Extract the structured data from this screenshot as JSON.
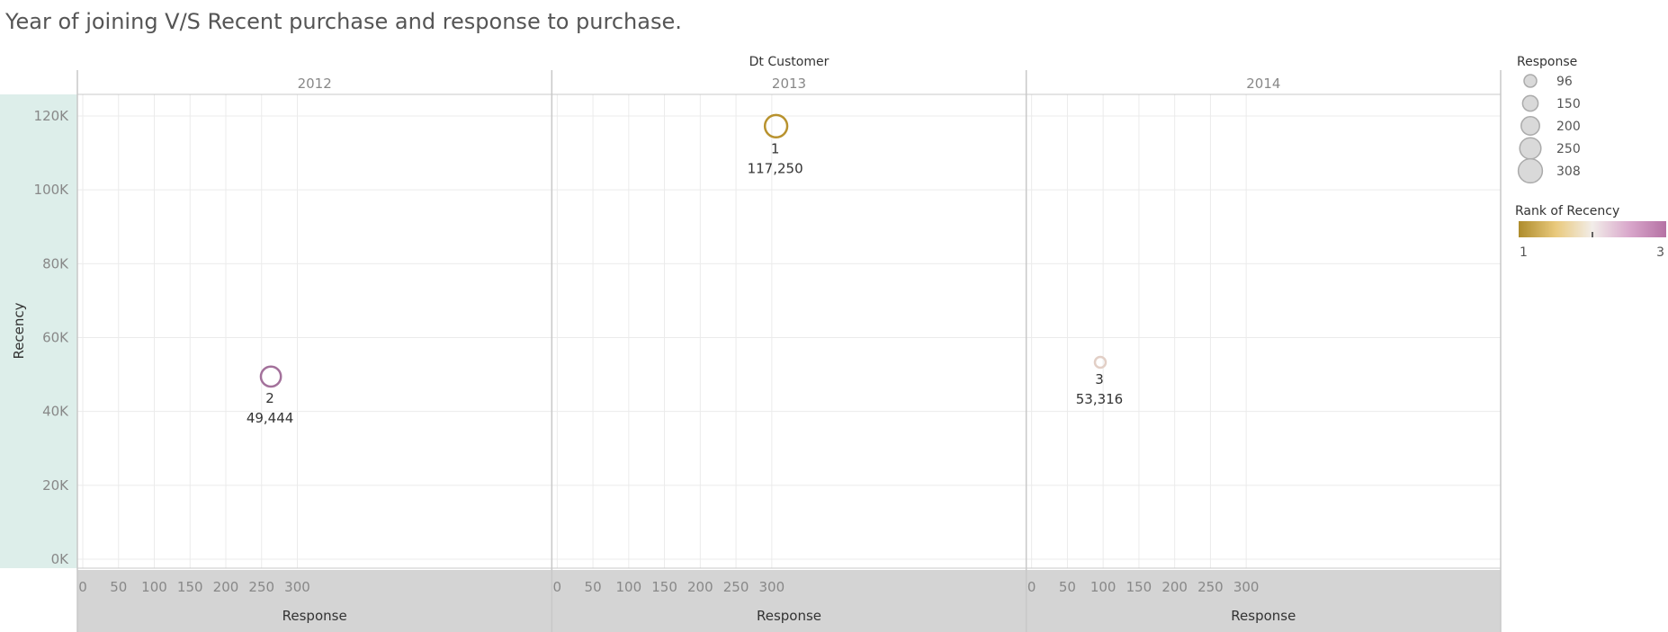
{
  "title": "Year of joining V/S Recent purchase and response to purchase.",
  "chart_data": {
    "type": "scatter",
    "column_header": "Dt Customer",
    "panels": [
      "2012",
      "2013",
      "2014"
    ],
    "xlabel": "Response",
    "ylabel": "Recency",
    "xlim": [
      0,
      330
    ],
    "ylim": [
      0,
      126000
    ],
    "x_ticks": [
      0,
      50,
      100,
      150,
      200,
      250,
      300
    ],
    "y_ticks": [
      0,
      20000,
      40000,
      60000,
      80000,
      100000,
      120000
    ],
    "y_tick_labels": [
      "0K",
      "20K",
      "40K",
      "60K",
      "80K",
      "100K",
      "120K"
    ],
    "grid": true,
    "points": [
      {
        "panel": "2012",
        "x": 263,
        "y": 49444,
        "rank": 2,
        "rank_label": "2",
        "value_label": "49,444",
        "color": "#A3719B"
      },
      {
        "panel": "2013",
        "x": 306,
        "y": 117250,
        "rank": 1,
        "rank_label": "1",
        "value_label": "117,250",
        "color": "#B8922E"
      },
      {
        "panel": "2014",
        "x": 96,
        "y": 53316,
        "rank": 3,
        "rank_label": "3",
        "value_label": "53,316",
        "color": "#E2CFC6"
      }
    ],
    "size_legend": {
      "title": "Response",
      "entries": [
        "96",
        "150",
        "200",
        "250",
        "308"
      ]
    },
    "color_legend": {
      "title": "Rank of Recency",
      "min_label": "1",
      "max_label": "3",
      "colors": [
        "#AE8C2C",
        "#E9C97C",
        "#F2EDE9",
        "#D9A7CB",
        "#B572A4"
      ]
    },
    "colors": {
      "panel_band": "#DDEEEA",
      "axis_band": "#D4D4D4",
      "grid": "#EBEBEB",
      "divider": "#C8C8C8"
    }
  }
}
